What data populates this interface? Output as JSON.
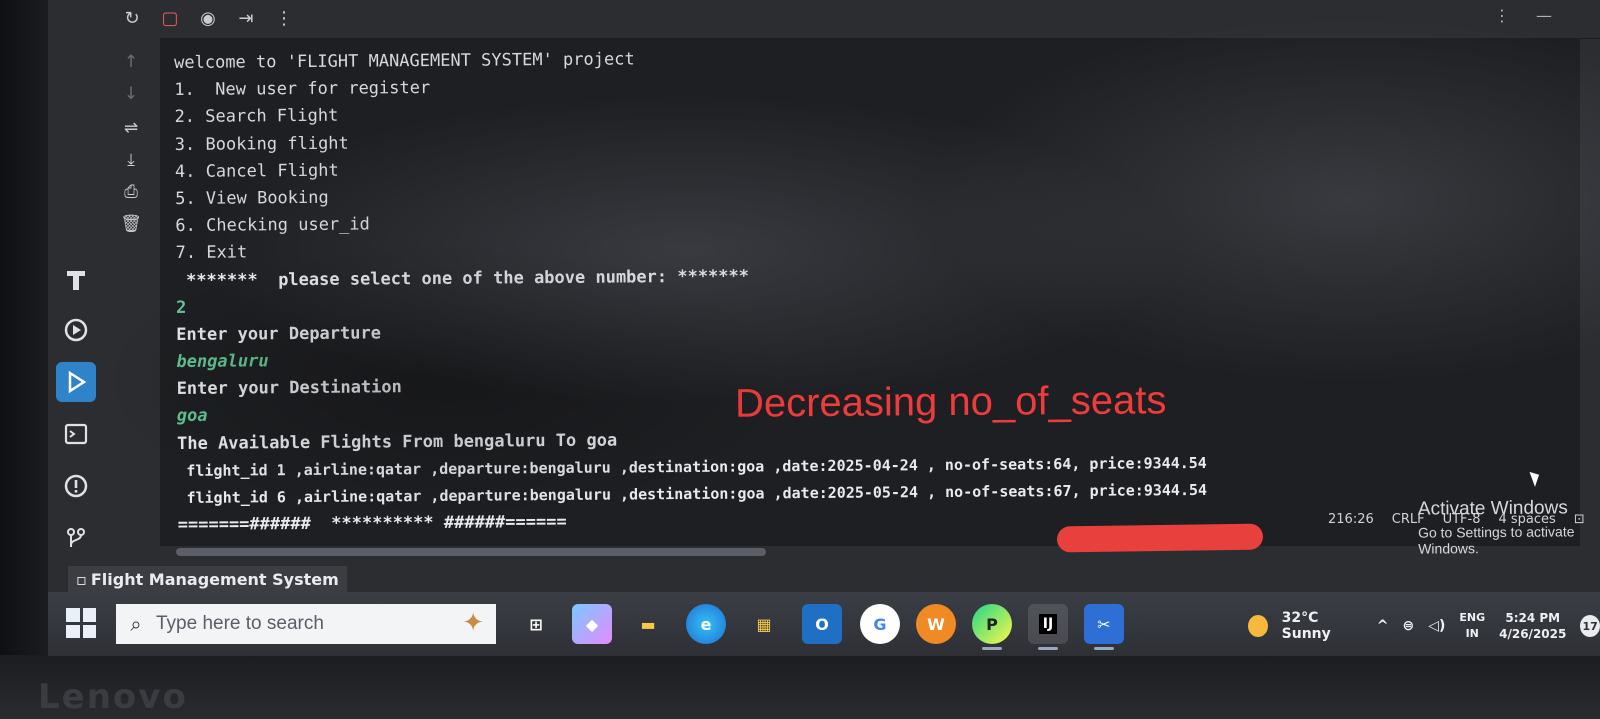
{
  "console": {
    "lines": [
      {
        "text": "welcome to 'FLIGHT MANAGEMENT SYSTEM' project",
        "style": "normal"
      },
      {
        "text": "1.  New user for register",
        "style": "normal"
      },
      {
        "text": "2. Search Flight",
        "style": "normal"
      },
      {
        "text": "3. Booking flight",
        "style": "normal"
      },
      {
        "text": "4. Cancel Flight",
        "style": "normal"
      },
      {
        "text": "5. View Booking",
        "style": "normal"
      },
      {
        "text": "6. Checking user_id",
        "style": "normal"
      },
      {
        "text": "7. Exit",
        "style": "normal"
      },
      {
        "text": " *******  please select one of the above number: *******",
        "style": "bold"
      },
      {
        "text": "2",
        "style": "input"
      },
      {
        "text": "Enter your Departure",
        "style": "bold"
      },
      {
        "text": "bengaluru",
        "style": "input-italic"
      },
      {
        "text": "Enter your Destination",
        "style": "bold"
      },
      {
        "text": "goa",
        "style": "input-italic"
      },
      {
        "text": "The Available Flights From bengaluru To goa",
        "style": "bold"
      },
      {
        "text": " flight_id 1 ,airline:qatar ,departure:bengaluru ,destination:goa ,date:2025-04-24 , no-of-seats:64, price:9344.54",
        "style": "small"
      },
      {
        "text": " flight_id 6 ,airline:qatar ,departure:bengaluru ,destination:goa ,date:2025-05-24 , no-of-seats:67, price:9344.54",
        "style": "small"
      },
      {
        "text": "=======######  ********** ######======",
        "style": "bold"
      }
    ]
  },
  "annotation": {
    "text": "Decreasing no_of_seats",
    "color": "#ee3b3b"
  },
  "activate_windows": {
    "title": "Activate Windows",
    "subtitle": "Go to Settings to activate Windows."
  },
  "status_bar": {
    "position": "216:26",
    "line_ending": "CRLF",
    "encoding": "UTF-8",
    "indent": "4 spaces"
  },
  "window_title": "Flight Management System",
  "taskbar": {
    "search_placeholder": "Type here to search",
    "weather": "32°C  Sunny",
    "lang_line1": "ENG",
    "lang_line2": "IN",
    "time": "5:24 PM",
    "date": "4/26/2025",
    "notification_count": "17",
    "apps": [
      {
        "name": "task-view",
        "glyph": "⊞"
      },
      {
        "name": "copilot",
        "glyph": "◆"
      },
      {
        "name": "file-explorer",
        "glyph": "▭"
      },
      {
        "name": "edge",
        "glyph": "e"
      },
      {
        "name": "store",
        "glyph": "▦"
      },
      {
        "name": "outlook",
        "glyph": "O"
      },
      {
        "name": "chrome",
        "glyph": "G"
      },
      {
        "name": "wps",
        "glyph": "W"
      },
      {
        "name": "pycharm",
        "glyph": "P"
      },
      {
        "name": "intellij",
        "glyph": "IJ"
      },
      {
        "name": "snipping",
        "glyph": "✂"
      }
    ]
  },
  "brand": "Lenovo",
  "colors": {
    "console_bg": "#1e1f22",
    "input_text": "#64c795",
    "active_tool": "#2f84c9"
  }
}
